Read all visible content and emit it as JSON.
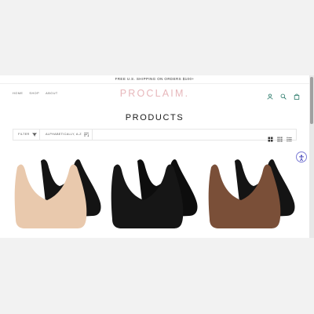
{
  "announcement": "FREE U.S. SHIPPING ON ORDERS $100+",
  "nav": {
    "home": "HOME",
    "shop": "SHOP",
    "about": "ABOUT"
  },
  "brand": {
    "name": "PROCLAIM",
    "dot": "."
  },
  "header_icons": [
    "account-icon",
    "search-icon",
    "cart-icon"
  ],
  "page_title": "PRODUCTS",
  "toolbar": {
    "filter_label": "FILTER",
    "sort_label": "ALPHABETICALLY, A-Z",
    "view_icons": [
      "grid-large-icon",
      "grid-small-icon",
      "list-icon"
    ]
  },
  "products": [
    {
      "name": "nude-bra-pair",
      "front_color": "#e9c9ad",
      "back_color": "#141414"
    },
    {
      "name": "black-bra-pair",
      "front_color": "#161616",
      "back_color": "#0d0d0d"
    },
    {
      "name": "brown-bra-pair",
      "front_color": "#7a4f38",
      "back_color": "#141414"
    }
  ],
  "colors": {
    "brand": "#e7b7bb",
    "accent": "#2a7a6a"
  }
}
